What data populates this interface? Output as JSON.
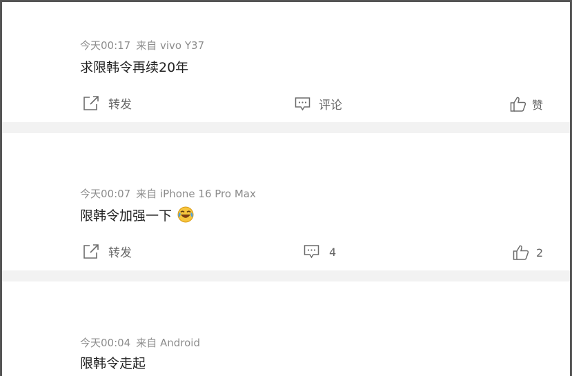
{
  "posts": [
    {
      "time": "今天00:17",
      "source": "来自 vivo Y37",
      "text": "求限韩令再续20年",
      "repost_label": "转发",
      "comment_label": "评论",
      "like_label": "赞"
    },
    {
      "time": "今天00:07",
      "source": "来自 iPhone 16 Pro Max",
      "text": "限韩令加强一下",
      "emoji": "laugh-cry-emoji",
      "repost_label": "转发",
      "comment_count": "4",
      "like_count": "2"
    },
    {
      "time": "今天00:04",
      "source": "来自 Android",
      "text": "限韩令走起"
    }
  ],
  "icons": {
    "repost": "share-icon",
    "comment": "comment-icon",
    "like": "thumbs-up-icon"
  },
  "colors": {
    "meta_text": "#8c8c8c",
    "body_text": "#222222",
    "action_text": "#666666",
    "divider": "#f2f2f2",
    "frame": "#555555"
  }
}
